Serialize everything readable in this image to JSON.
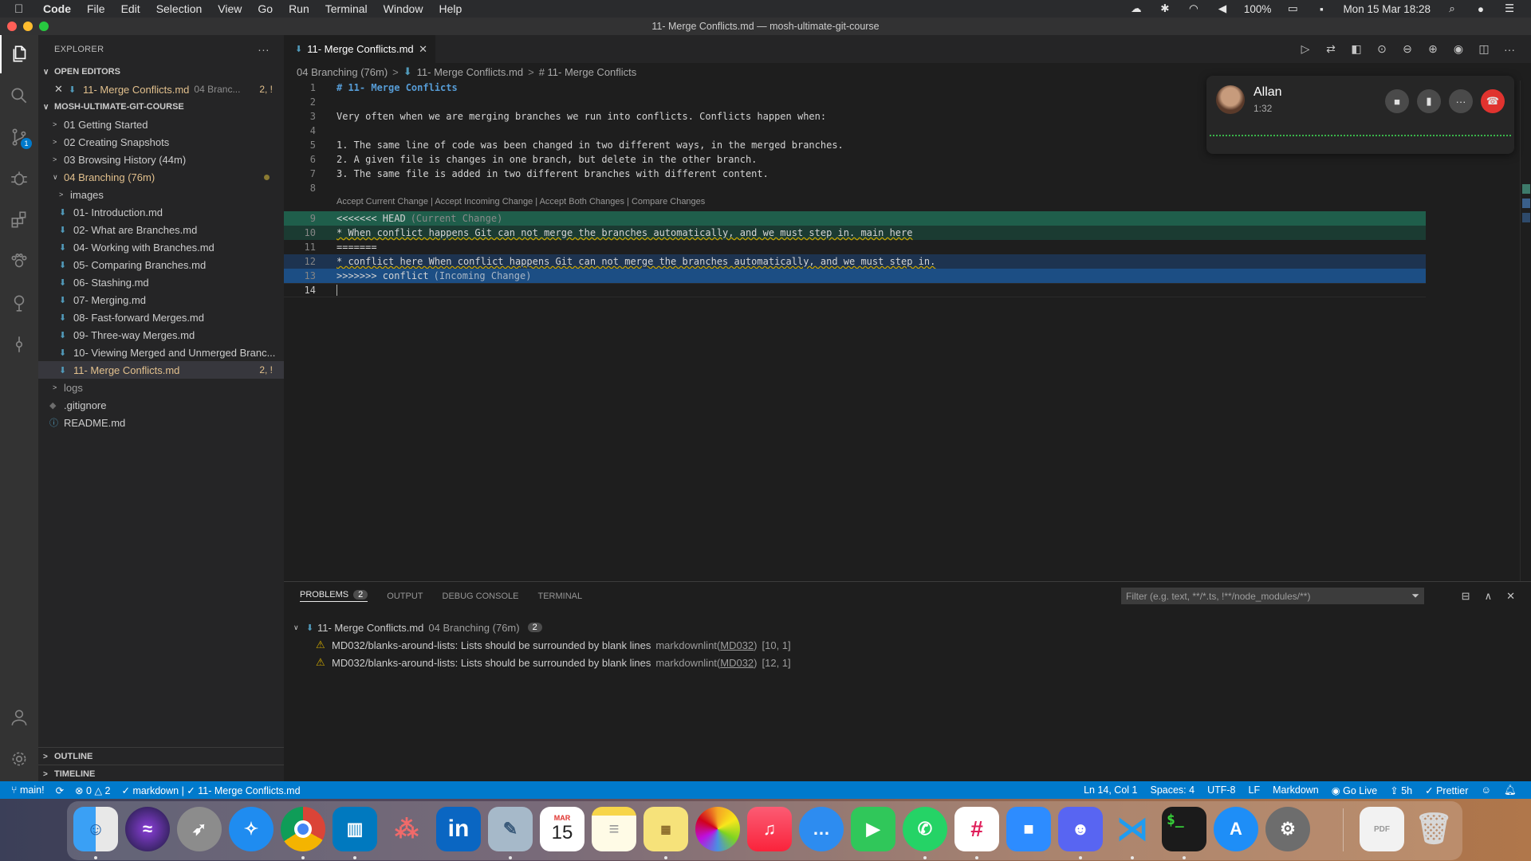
{
  "menubar": {
    "app": "Code",
    "items": [
      "File",
      "Edit",
      "Selection",
      "View",
      "Go",
      "Run",
      "Terminal",
      "Window",
      "Help"
    ],
    "battery": "100%",
    "datetime": "Mon 15 Mar  18:28"
  },
  "window": {
    "title": "11- Merge Conflicts.md — mosh-ultimate-git-course"
  },
  "activity": {
    "scm_badge": "1"
  },
  "explorer": {
    "title": "EXPLORER",
    "open_editors_label": "OPEN EDITORS",
    "open_editor": {
      "close": "✕",
      "name": "11- Merge Conflicts.md",
      "desc": "04 Branc...",
      "tail": "2, !"
    },
    "project_label": "MOSH-ULTIMATE-GIT-COURSE",
    "folders": [
      "01 Getting Started",
      "02 Creating Snapshots",
      "03 Browsing History (44m)"
    ],
    "open_folder": "04 Branching (76m)",
    "images_folder": "images",
    "files": [
      "01- Introduction.md",
      "02- What are Branches.md",
      "04- Working with Branches.md",
      "05- Comparing Branches.md",
      "06- Stashing.md",
      "07- Merging.md",
      "08- Fast-forward Merges.md",
      "09- Three-way Merges.md",
      "10- Viewing Merged and Unmerged Branc..."
    ],
    "active_file": {
      "name": "11- Merge Conflicts.md",
      "tail": "2, !"
    },
    "logs": "logs",
    "gitignore": ".gitignore",
    "readme": "README.md",
    "outline": "OUTLINE",
    "timeline": "TIMELINE"
  },
  "tab": {
    "label": "11- Merge Conflicts.md"
  },
  "breadcrumbs": [
    "04 Branching (76m)",
    "11- Merge Conflicts.md",
    "# 11- Merge Conflicts"
  ],
  "editor": {
    "codelens": "Accept Current Change | Accept Incoming Change | Accept Both Changes | Compare Changes",
    "lines": [
      "# 11- Merge Conflicts",
      "",
      "Very often when we are merging branches we run into conflicts. Conflicts happen when:",
      "",
      "1. The same line of code was been changed in two different ways, in the merged branches.",
      "2. A given file is changes in one branch, but delete in the other branch.",
      "3. The same file is added in two different branches with different content.",
      "",
      "<<<<<<< HEAD",
      "* When conflict happens Git can not merge the branches automatically, and we must step in. main here",
      "=======",
      "* conflict here When conflict happens Git can not merge the branches automatically, and we must step in.",
      ">>>>>>> conflict",
      ""
    ],
    "current_change": "(Current Change)",
    "incoming_change": "(Incoming Change)"
  },
  "call": {
    "name": "Allan",
    "duration": "1:32"
  },
  "panel": {
    "tabs": [
      "PROBLEMS",
      "OUTPUT",
      "DEBUG CONSOLE",
      "TERMINAL"
    ],
    "problem_count": "2",
    "filter_placeholder": "Filter (e.g. text, **/*.ts, !**/node_modules/**)",
    "group": {
      "file": "11- Merge Conflicts.md",
      "folder": "04 Branching (76m)",
      "count": "2"
    },
    "problems": [
      {
        "msg": "MD032/blanks-around-lists: Lists should be surrounded by blank lines",
        "src": "markdownlint(",
        "code": "MD032",
        "src_end": ")",
        "pos": "[10, 1]"
      },
      {
        "msg": "MD032/blanks-around-lists: Lists should be surrounded by blank lines",
        "src": "markdownlint(",
        "code": "MD032",
        "src_end": ")",
        "pos": "[12, 1]"
      }
    ]
  },
  "statusbar": {
    "branch": "main!",
    "errors": "0",
    "warnings": "2",
    "lint": "markdown | ✓ 11- Merge Conflicts.md",
    "position": "Ln 14, Col 1",
    "spaces": "Spaces: 4",
    "encoding": "UTF-8",
    "eol": "LF",
    "language": "Markdown",
    "golive": "Go Live",
    "time": "5h",
    "prettier": "Prettier"
  },
  "dock": {
    "calendar_month": "MAR",
    "calendar_day": "15",
    "apps": [
      "finder-icon",
      "siri-icon",
      "launchpad-icon",
      "safari-icon",
      "chrome-icon",
      "trello-icon",
      "asana-icon",
      "linkedin-icon",
      "preview-icon",
      "calendar-icon",
      "notes-icon",
      "stickies-icon",
      "photos-icon",
      "music-icon",
      "messages-icon",
      "facetime-icon",
      "whatsapp-icon",
      "slack-icon",
      "zoom-icon",
      "discord-icon",
      "vscode-icon",
      "terminal-icon",
      "appstore-icon",
      "system-preferences-icon"
    ]
  },
  "colors": {
    "accent": "#007acc",
    "current_change": "#1f5e4b",
    "incoming_change": "#1c4e84"
  }
}
